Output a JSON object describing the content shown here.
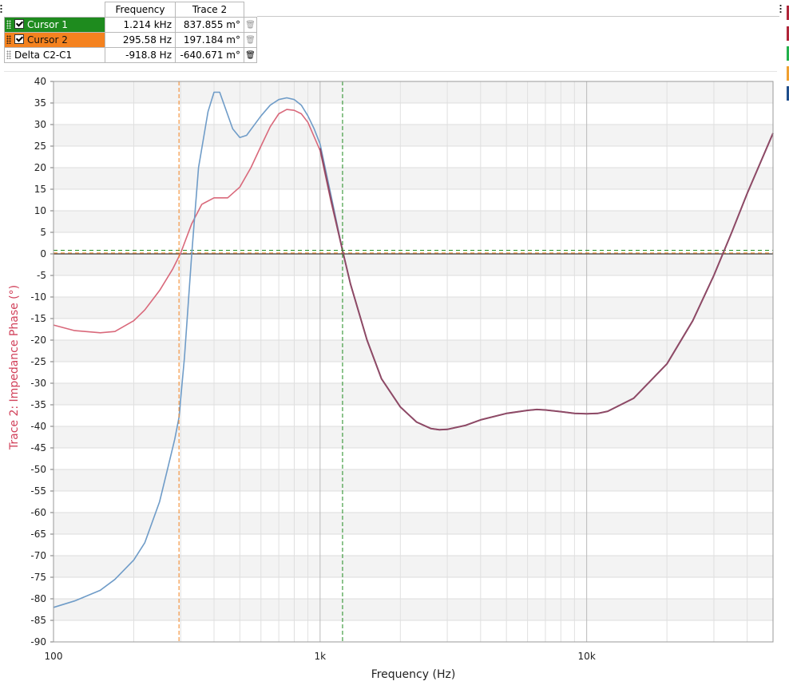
{
  "cursor_table": {
    "headers": [
      "Frequency",
      "Trace 2"
    ],
    "rows": [
      {
        "name": "Cursor 1",
        "frequency": "1.214 kHz",
        "trace": "837.855 m°",
        "checked": true,
        "color": "#1e8b1e"
      },
      {
        "name": "Cursor 2",
        "frequency": "295.58 Hz",
        "trace": "197.184 m°",
        "checked": true,
        "color": "#f4821f"
      },
      {
        "name": "Delta C2-C1",
        "frequency": "-918.8 Hz",
        "trace": "-640.671 m°"
      }
    ]
  },
  "trace_swatches": [
    "#b0263a",
    "#b0263a",
    "#22b14c",
    "#f0a030",
    "#1f4e8c"
  ],
  "chart_data": {
    "type": "line",
    "xlabel": "Frequency (Hz)",
    "ylabel": "Trace 2: Impedance Phase (°)",
    "ylabel_color": "#d1415a",
    "x_scale": "log",
    "xlim": [
      100,
      50000
    ],
    "ylim": [
      -90,
      40
    ],
    "y_ticks": [
      40,
      35,
      30,
      25,
      20,
      15,
      10,
      5,
      0,
      -5,
      -10,
      -15,
      -20,
      -25,
      -30,
      -35,
      -40,
      -45,
      -50,
      -55,
      -60,
      -65,
      -70,
      -75,
      -80,
      -85,
      -90
    ],
    "x_tick_labels": [
      {
        "x": 100,
        "label": "100"
      },
      {
        "x": 1000,
        "label": "1k"
      },
      {
        "x": 10000,
        "label": "10k"
      }
    ],
    "grid": true,
    "cursors": [
      {
        "name": "Cursor 1",
        "frequency_hz": 1214,
        "value_deg": 0.838,
        "color": "#1e8b1e"
      },
      {
        "name": "Cursor 2",
        "frequency_hz": 295.58,
        "value_deg": 0.197,
        "color": "#f4821f"
      }
    ],
    "series": [
      {
        "color": "#d9697b",
        "x": [
          100,
          120,
          150,
          170,
          200,
          220,
          250,
          280,
          300,
          330,
          360,
          400,
          450,
          500,
          550,
          600,
          650,
          700,
          750,
          800,
          850,
          900,
          1000,
          1100,
          1214,
          1300,
          1500,
          1700,
          2000,
          2300,
          2600,
          2800,
          3000,
          3500,
          4000,
          5000,
          6000,
          6500,
          7000,
          8000,
          9000,
          10000,
          11000,
          12000,
          15000,
          20000,
          25000,
          30000,
          35000,
          40000,
          50000
        ],
        "y": [
          -16.5,
          -17.8,
          -18.3,
          -18,
          -15.5,
          -13,
          -8.5,
          -3.5,
          0.2,
          7,
          11.5,
          13,
          13,
          15.5,
          20,
          25,
          29.5,
          32.5,
          33.5,
          33.3,
          32.5,
          30.5,
          24,
          12,
          0.8,
          -7,
          -20,
          -29,
          -35.5,
          -39,
          -40.5,
          -40.8,
          -40.7,
          -39.8,
          -38.5,
          -37,
          -36.3,
          -36.1,
          -36.2,
          -36.6,
          -37,
          -37.1,
          -37,
          -36.5,
          -33.5,
          -25.5,
          -15.5,
          -5,
          5,
          14,
          28
        ]
      },
      {
        "color": "#6f9cc8",
        "x": [
          100,
          120,
          150,
          170,
          200,
          220,
          250,
          270,
          285,
          295.58,
          310,
          330,
          350,
          380,
          400,
          420,
          440,
          470,
          500,
          530,
          560,
          600,
          650,
          700,
          750,
          800,
          850,
          900,
          950,
          1000,
          1100,
          1214,
          1300,
          1500,
          1700,
          2000,
          2300,
          2600,
          2800,
          3000,
          3500,
          4000,
          5000,
          6000,
          6500,
          7000,
          8000,
          9000,
          10000,
          11000,
          12000,
          15000,
          20000,
          25000,
          30000,
          35000,
          40000,
          50000
        ],
        "y": [
          -82,
          -80.5,
          -78,
          -75.5,
          -71,
          -67,
          -57.5,
          -49,
          -43,
          -38,
          -24,
          0,
          20,
          33,
          37.5,
          37.5,
          34,
          29,
          27,
          27.5,
          29.5,
          32,
          34.5,
          35.8,
          36.2,
          35.8,
          34.5,
          32,
          29,
          25.5,
          13.5,
          0.8,
          -7,
          -20,
          -29,
          -35.5,
          -39,
          -40.5,
          -40.8,
          -40.7,
          -39.8,
          -38.5,
          -37,
          -36.3,
          -36.1,
          -36.2,
          -36.6,
          -37,
          -37.1,
          -37,
          -36.5,
          -33.5,
          -25.5,
          -15.5,
          -5,
          5,
          14,
          28
        ]
      },
      {
        "color": "#8e4a66",
        "x": [
          1000,
          1100,
          1214,
          1300,
          1500,
          1700,
          2000,
          2300,
          2600,
          2800,
          3000,
          3500,
          4000,
          5000,
          6000,
          6500,
          7000,
          8000,
          9000,
          10000,
          11000,
          12000,
          15000,
          20000,
          25000,
          30000,
          35000,
          40000,
          50000
        ],
        "y": [
          24.5,
          12.5,
          0.8,
          -7,
          -20,
          -29,
          -35.5,
          -39,
          -40.5,
          -40.8,
          -40.7,
          -39.8,
          -38.5,
          -37,
          -36.3,
          -36.1,
          -36.2,
          -36.6,
          -37,
          -37.1,
          -37,
          -36.5,
          -33.5,
          -25.5,
          -15.5,
          -5,
          5,
          14,
          28
        ]
      }
    ]
  }
}
